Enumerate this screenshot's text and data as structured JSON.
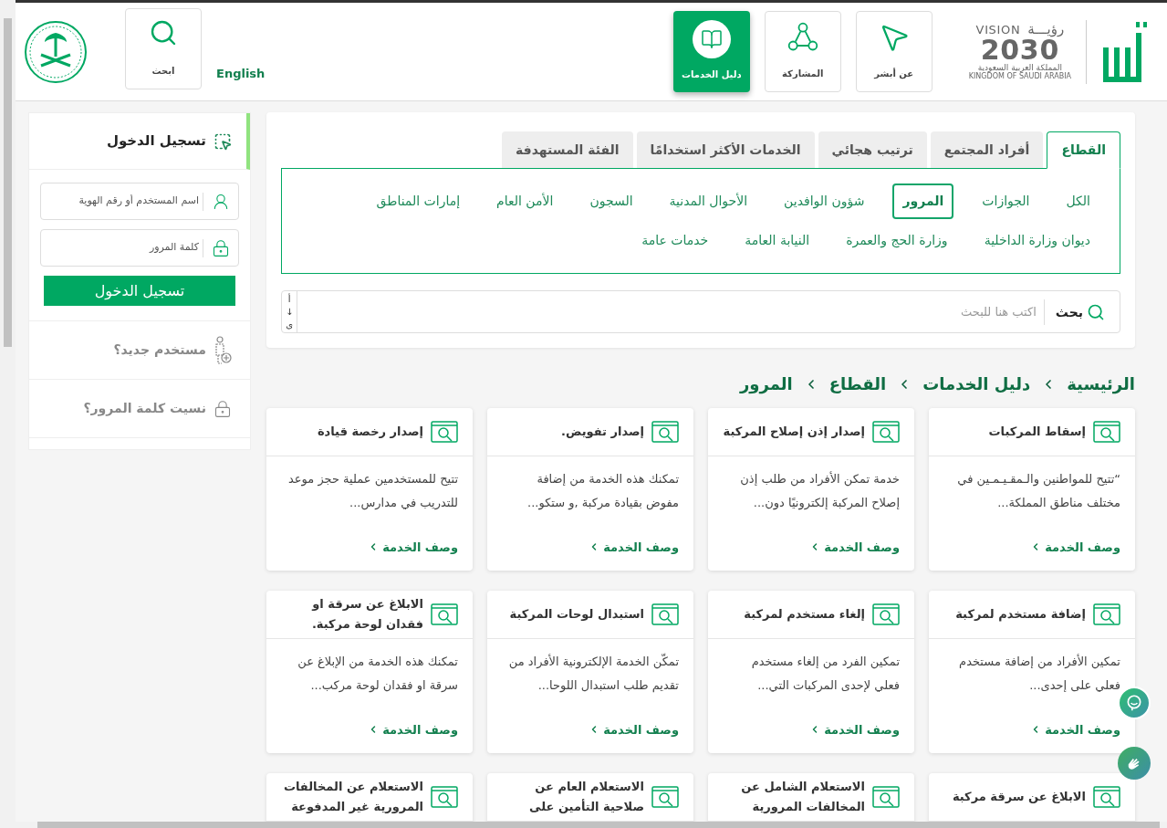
{
  "header": {
    "nav": [
      {
        "label": "عن أبشر",
        "selected": false
      },
      {
        "label": "المشاركة",
        "selected": false
      },
      {
        "label": "دليل الخدمات",
        "selected": true
      }
    ],
    "vision_logo": {
      "arabic": "رؤيـــة",
      "latin": "VISION",
      "year": "2030",
      "country_ar": "المملكة العربية السعودية",
      "country_en": "KINGDOM OF SAUDI ARABIA"
    },
    "language": "English",
    "search_button": "ابحث"
  },
  "login": {
    "title": "تسجيل الدخول",
    "username_placeholder": "اسم المستخدم أو رقم الهوية",
    "password_placeholder": "كلمة المرور",
    "submit": "تسجيل الدخول",
    "links": [
      "مستخدم جديد؟",
      "نسيت كلمة المرور؟"
    ]
  },
  "tabs": [
    {
      "label": "القطاع",
      "selected": true
    },
    {
      "label": "أفراد المجتمع",
      "selected": false
    },
    {
      "label": "ترتيب هجائي",
      "selected": false
    },
    {
      "label": "الخدمات الأكثر استخدامًا",
      "selected": false
    },
    {
      "label": "الفئة المستهدفة",
      "selected": false
    }
  ],
  "filters": [
    {
      "label": "الكل",
      "selected": false
    },
    {
      "label": "الجوازات",
      "selected": false
    },
    {
      "label": "المرور",
      "selected": true
    },
    {
      "label": "شؤون الوافدين",
      "selected": false
    },
    {
      "label": "الأحوال المدنية",
      "selected": false
    },
    {
      "label": "السجون",
      "selected": false
    },
    {
      "label": "الأمن العام",
      "selected": false
    },
    {
      "label": "إمارات المناطق",
      "selected": false
    },
    {
      "label": "ديوان وزارة الداخلية",
      "selected": false
    },
    {
      "label": "وزارة الحج والعمرة",
      "selected": false
    },
    {
      "label": "النيابة العامة",
      "selected": false
    },
    {
      "label": "خدمات عامة",
      "selected": false
    }
  ],
  "search": {
    "label": "بحث",
    "placeholder": "اكتب هنا للبحث",
    "sort": [
      "أ",
      "↓",
      "ى"
    ]
  },
  "breadcrumb": [
    "الرئيسية",
    "دليل الخدمات",
    "القطاع",
    "المرور"
  ],
  "cards": [
    {
      "title": "إسقاط المركبات",
      "description": "“تتيح للمواطنين والـمقـيـمـين في مختلف مناطق المملكة...",
      "link": "وصف الخدمة"
    },
    {
      "title": "إصدار إذن إصلاح المركبة",
      "description": "خدمة تمكن الأفراد من طلب إذن إصلاح المركبة إلكترونيًا دون...",
      "link": "وصف الخدمة"
    },
    {
      "title": "إصدار تفويض.",
      "description": "تمكنك هذه الخدمة من إضافة مفوض بقيادة مركبة ,و ستكو...",
      "link": "وصف الخدمة"
    },
    {
      "title": "إصدار رخصة قيادة",
      "description": "تتيح للمستخدمين عملية حجز موعد للتدريب في مدارس...",
      "link": "وصف الخدمة"
    },
    {
      "title": "إضافة مستخدم لمركبة",
      "description": "تمكين الأفراد من إضافة مستخدم فعلي على إحدى...",
      "link": "وصف الخدمة"
    },
    {
      "title": "إلغاء مستخدم لمركبة",
      "description": "تمكين الفرد من إلغاء مستخدم فعلي لإحدى المركبات التي...",
      "link": "وصف الخدمة"
    },
    {
      "title": "استبدال لوحات المركبة",
      "description": "تمكّن الخدمة الإلكترونية الأفراد من تقديم طلب استبدال اللوحا...",
      "link": "وصف الخدمة"
    },
    {
      "title": "الابلاغ عن سرقة او فقدان لوحة مركبة.",
      "description": "تمكنك هذه الخدمة من الإبلاغ عن سرقة او فقدان لوحة مركب...",
      "link": "وصف الخدمة"
    },
    {
      "title": "الابلاغ عن سرقة مركبة"
    },
    {
      "title": "الاستعلام الشامل عن المخالفات المرورية"
    },
    {
      "title": "الاستعلام العام عن صلاحية التأمين على"
    },
    {
      "title": "الاستعلام عن المخالفات المرورية غير المدفوعة"
    }
  ]
}
